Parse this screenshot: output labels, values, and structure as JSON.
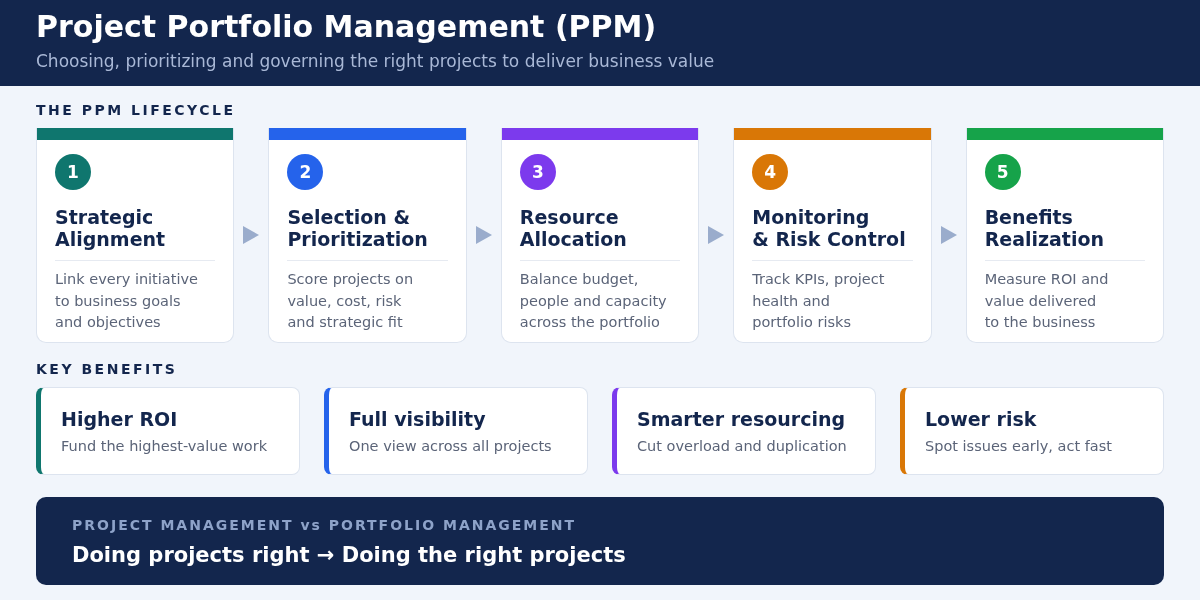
{
  "header": {
    "title": "Project Portfolio Management (PPM)",
    "subtitle": "Choosing, prioritizing and governing the right projects to deliver business value"
  },
  "lifecycle": {
    "heading": "THE PPM LIFECYCLE",
    "steps": [
      {
        "number": "1",
        "title_lines": [
          "Strategic",
          "Alignment"
        ],
        "text_lines": [
          "Link every initiative",
          "to business goals",
          "and objectives"
        ],
        "color": "#0f766e"
      },
      {
        "number": "2",
        "title_lines": [
          "Selection &",
          "Prioritization"
        ],
        "text_lines": [
          "Score projects on",
          "value, cost, risk",
          "and strategic fit"
        ],
        "color": "#2563eb"
      },
      {
        "number": "3",
        "title_lines": [
          "Resource",
          "Allocation"
        ],
        "text_lines": [
          "Balance budget,",
          "people and capacity",
          "across the portfolio"
        ],
        "color": "#7c3aed"
      },
      {
        "number": "4",
        "title_lines": [
          "Monitoring",
          "& Risk Control"
        ],
        "text_lines": [
          "Track KPIs, project",
          "health and",
          "portfolio risks"
        ],
        "color": "#d97706"
      },
      {
        "number": "5",
        "title_lines": [
          "Benefits",
          "Realization"
        ],
        "text_lines": [
          "Measure ROI and",
          "value delivered",
          "to the business"
        ],
        "color": "#16a34a"
      }
    ]
  },
  "benefits": {
    "heading": "KEY BENEFITS",
    "items": [
      {
        "title": "Higher ROI",
        "text": "Fund the highest-value work",
        "color": "#0f766e"
      },
      {
        "title": "Full visibility",
        "text": "One view across all projects",
        "color": "#2563eb"
      },
      {
        "title": "Smarter resourcing",
        "text": "Cut overload and duplication",
        "color": "#7c3aed"
      },
      {
        "title": "Lower risk",
        "text": "Spot issues early, act fast",
        "color": "#d97706"
      }
    ]
  },
  "comparison": {
    "label": "PROJECT MANAGEMENT vs PORTFOLIO MANAGEMENT",
    "headline": "Doing projects right → Doing the right projects"
  }
}
